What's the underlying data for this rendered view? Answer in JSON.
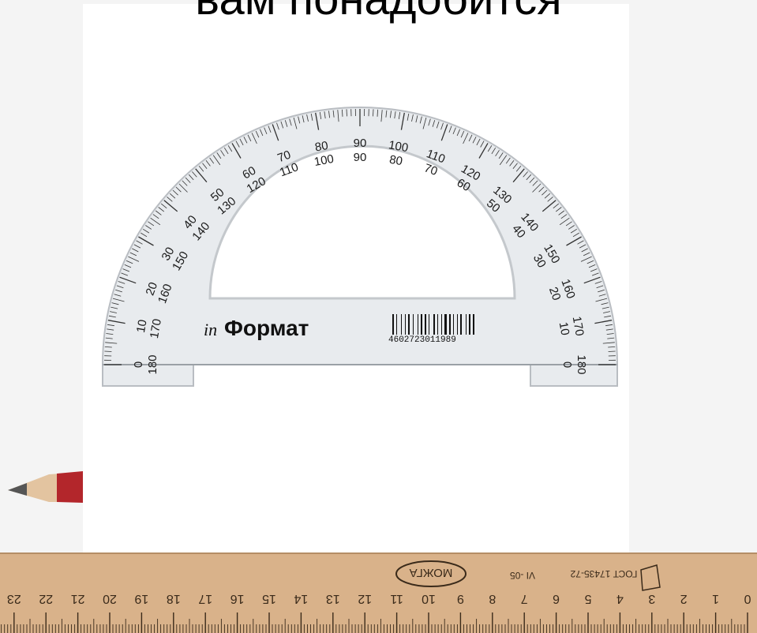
{
  "heading": "вам понадобится",
  "protractor": {
    "brand_prefix": "in",
    "brand_name": "Формат",
    "barcode_number": "4602723011989",
    "outer_labels": [
      "0",
      "10",
      "20",
      "30",
      "40",
      "50",
      "60",
      "70",
      "80",
      "90",
      "100",
      "110",
      "120",
      "130",
      "140",
      "150",
      "160",
      "170",
      "180"
    ],
    "inner_labels": [
      "180",
      "170",
      "160",
      "150",
      "140",
      "130",
      "120",
      "110",
      "100",
      "90",
      "80",
      "70",
      "60",
      "50",
      "40",
      "30",
      "20",
      "10",
      "0"
    ]
  },
  "ruler": {
    "maker": "МОЖГА",
    "standard": "ГОСТ 17435-72",
    "batch": "VI -05",
    "numbers": [
      "0",
      "1",
      "2",
      "3",
      "4",
      "5",
      "6",
      "7",
      "8",
      "9",
      "10",
      "11",
      "12",
      "13",
      "14",
      "15",
      "16",
      "17",
      "18",
      "19",
      "20",
      "21",
      "22",
      "23"
    ]
  },
  "colors": {
    "ruler_wood": "#d9b28a",
    "pencil_lead": "#555555",
    "pencil_red": "#b3262b",
    "pencil_wood": "#e3c4a0"
  }
}
